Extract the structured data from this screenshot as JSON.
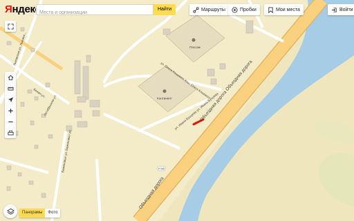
{
  "logo": {
    "first": "Я",
    "rest": "ндекс"
  },
  "search": {
    "placeholder": "Места и организации",
    "value": "",
    "button": "Найти"
  },
  "toolbar": {
    "routes": "Маршруты",
    "traffic": "Пробки",
    "my_places": "Мои места",
    "login": "Войти"
  },
  "map_labels": {
    "street_lvovskaya": "Львовская ул. Львовск...",
    "street_belaya": "Белая ул.",
    "street_oktyabrskaya": "Октябрьская ул.",
    "street_bazhenovykh": "Баженовых ул. Баженовых ул.",
    "street_olega_koshevogo": "ул. Олега Кошевого Кош. Олега Кошевого",
    "street_ivana_bushuev": "ул. Ивана Бушуева ул. Ивана Бушуева",
    "bypass": "Объездная дорога Объездная дорога",
    "bypass_lower": "Объездная дорога",
    "poi_1": "Пассаж",
    "poi_2": "Континент",
    "road_badge": "Р-85"
  },
  "modes": {
    "scheme": "Панорамы",
    "satellite": "Фото"
  },
  "colors": {
    "land": "#f4ecc8",
    "river": "#a6cde5",
    "road": "#fad17f",
    "road_outline": "#e3b567",
    "accent": "#ffdb4d",
    "traffic_jam": "#e61400",
    "brand": "#e61400"
  }
}
